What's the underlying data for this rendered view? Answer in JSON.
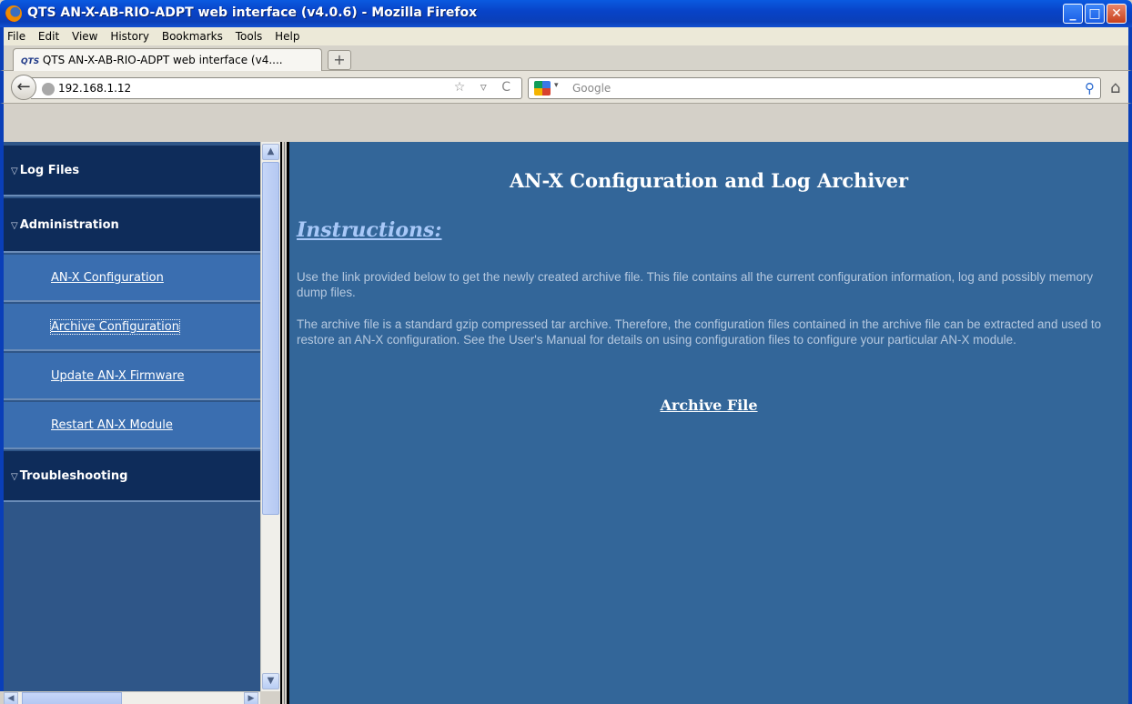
{
  "window": {
    "title": "QTS AN-X-AB-RIO-ADPT web interface (v4.0.6) - Mozilla Firefox",
    "minimize": "_",
    "maximize": "□",
    "close": "✕"
  },
  "menu": [
    "File",
    "Edit",
    "View",
    "History",
    "Bookmarks",
    "Tools",
    "Help"
  ],
  "tab": {
    "favicon": "QTS",
    "label": "QTS AN-X-AB-RIO-ADPT web interface (v4....",
    "new_tab": "+"
  },
  "nav": {
    "back": "←",
    "url": "192.168.1.12",
    "url_icons": "☆ ▿ C",
    "search_placeholder": "Google",
    "search_engine_arrow": "▾",
    "search_button": "⚲",
    "home": "⌂"
  },
  "sidebar": {
    "sections": [
      {
        "label": "Log Files"
      },
      {
        "label": "Administration"
      },
      {
        "label": "Troubleshooting"
      }
    ],
    "links": [
      {
        "label": "AN-X Configuration"
      },
      {
        "label": "Archive Configuration"
      },
      {
        "label": "Update AN-X Firmware"
      },
      {
        "label": "Restart AN-X Module"
      }
    ],
    "section_arrow": "▽"
  },
  "main": {
    "heading": "AN-X Configuration and Log Archiver",
    "instructions_label": "Instructions:",
    "paragraph1": "Use the link provided below to get the newly created archive file. This file contains all the current configuration information, log and possibly memory dump files.",
    "paragraph2": "The archive file is a standard gzip compressed tar archive. Therefore, the configuration files contained in the archive file can be extracted and used to restore an AN-X configuration. See the User's Manual for details on using configuration files to configure your particular AN-X module.",
    "archive_link": "Archive File"
  },
  "scroll": {
    "up": "▲",
    "down": "▼",
    "left": "◀",
    "right": "▶"
  },
  "colors": {
    "sidebar_header": "#0e2c5a",
    "sidebar_link": "#3a6eb0",
    "main_bg": "#336699",
    "titlebar": "#0a3fb8"
  }
}
